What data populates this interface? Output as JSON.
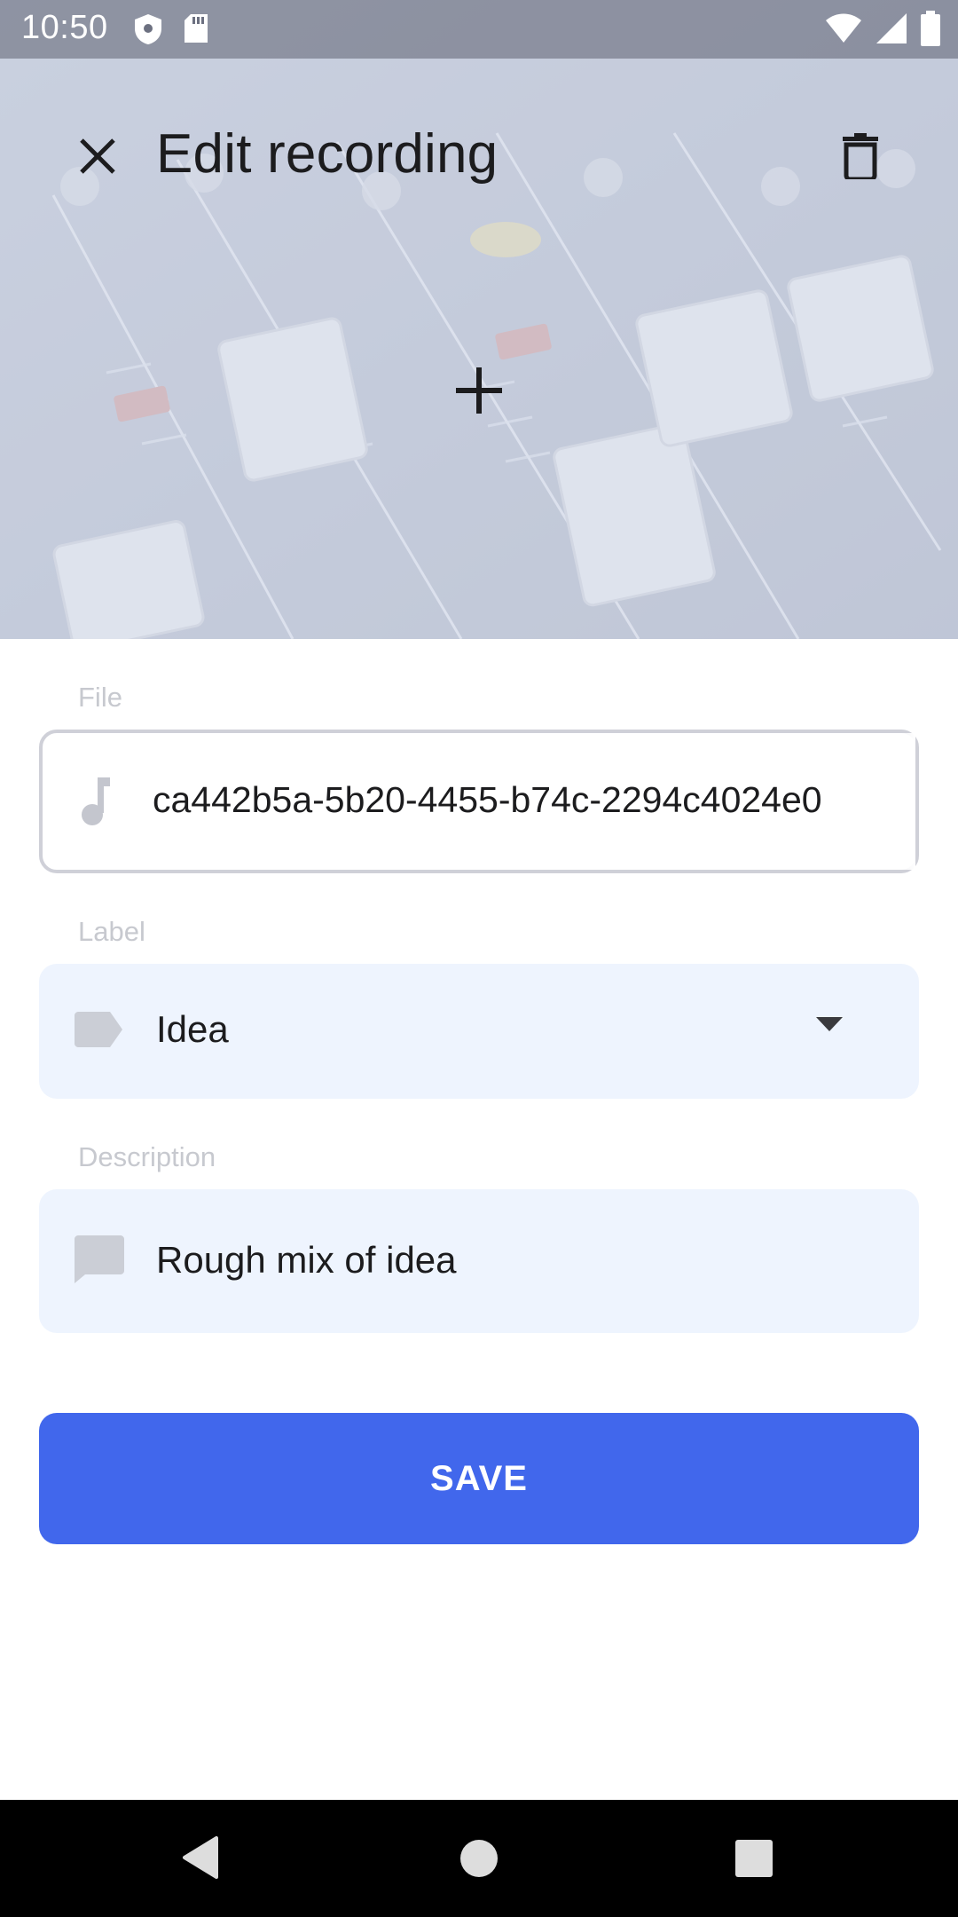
{
  "status_bar": {
    "time": "10:50",
    "left_icons": [
      "shield-icon",
      "sd-card-icon"
    ],
    "right_icons": [
      "wifi-icon",
      "cellular-signal-icon",
      "battery-icon"
    ]
  },
  "toolbar": {
    "title": "Edit recording",
    "close_icon": "close-icon",
    "delete_icon": "delete-icon",
    "add_image_icon": "plus-icon"
  },
  "form": {
    "file": {
      "label": "File",
      "icon": "music-note-icon",
      "value": "ca442b5a-5b20-4455-b74c-2294c4024e0"
    },
    "label_select": {
      "label": "Label",
      "icon": "label-tag-icon",
      "value": "Idea"
    },
    "description": {
      "label": "Description",
      "icon": "comment-icon",
      "value": "Rough mix of idea"
    },
    "save_label": "SAVE"
  },
  "colors": {
    "accent": "#4167ec",
    "field_fill": "#eef4fe",
    "field_border": "#cfd0d8",
    "label_text": "#c7c9cf"
  },
  "nav_bar": {
    "icons": [
      "back-icon",
      "home-icon",
      "recents-icon"
    ]
  }
}
